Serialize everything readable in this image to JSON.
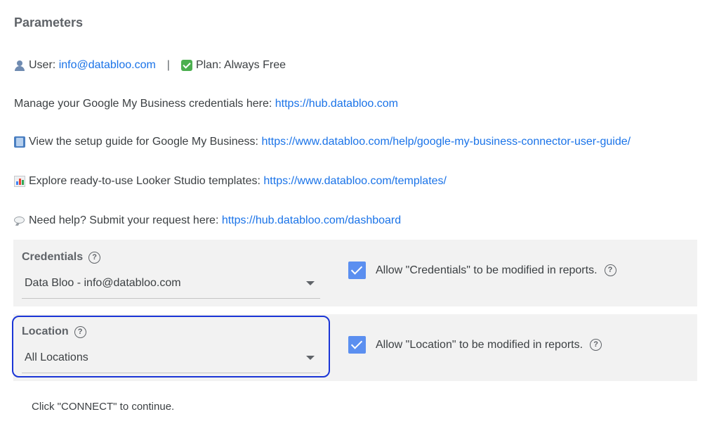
{
  "title": "Parameters",
  "user_line": {
    "user_label": "User:",
    "user_email": "info@databloo.com",
    "separator": "|",
    "plan_label": "Plan: Always Free",
    "user_icon": "user-icon",
    "plan_icon": "check-icon"
  },
  "credentials_line": {
    "text": "Manage your Google My Business credentials here:",
    "link": "https://hub.databloo.com"
  },
  "guide_line": {
    "icon": "book-icon",
    "text": "View the setup guide for Google My Business:",
    "link": "https://www.databloo.com/help/google-my-business-connector-user-guide/"
  },
  "templates_line": {
    "icon": "chart-icon",
    "text": "Explore ready-to-use Looker Studio templates:",
    "link": "https://www.databloo.com/templates/"
  },
  "help_line": {
    "icon": "speech-icon",
    "text": "Need help? Submit your request here:",
    "link": "https://hub.databloo.com/dashboard"
  },
  "credentials_field": {
    "label": "Credentials",
    "value": "Data Bloo - info@databloo.com",
    "allow_text": "Allow \"Credentials\" to be modified in reports.",
    "allow_checked": true
  },
  "location_field": {
    "label": "Location",
    "value": "All Locations",
    "allow_text": "Allow \"Location\" to be modified in reports.",
    "allow_checked": true
  },
  "help_glyph": "?",
  "footer": "Click \"CONNECT\" to continue.",
  "colors": {
    "link": "#1a73e8",
    "checkbox": "#5b8ff0",
    "highlight": "#1a35d6",
    "panel": "#f2f2f2"
  }
}
